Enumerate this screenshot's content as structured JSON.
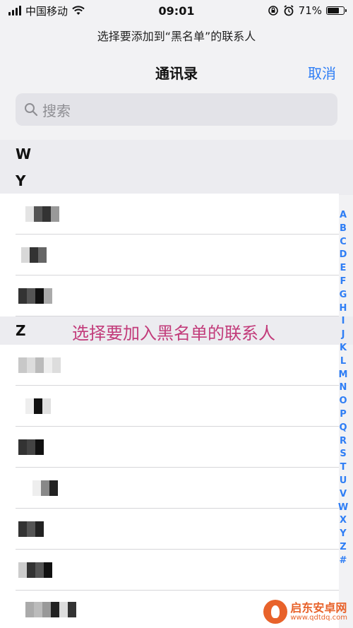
{
  "status_bar": {
    "carrier": "中国移动",
    "time": "09:01",
    "battery": "71%",
    "battery_level": 0.71
  },
  "header": {
    "prompt": "选择要添加到“黑名单”的联系人",
    "title": "通讯录",
    "cancel_label": "取消"
  },
  "search": {
    "placeholder": "搜索"
  },
  "sections": {
    "w": "W",
    "y": "Y",
    "z": "Z"
  },
  "annotation": "选择要加入黑名单的联系人",
  "index_letters": [
    "A",
    "B",
    "C",
    "D",
    "E",
    "F",
    "G",
    "H",
    "I",
    "J",
    "K",
    "L",
    "M",
    "N",
    "O",
    "P",
    "Q",
    "R",
    "S",
    "T",
    "U",
    "V",
    "W",
    "X",
    "Y",
    "Z",
    "#"
  ],
  "watermark": {
    "name": "启东安卓网",
    "url": "www.qdtdq.com"
  },
  "colors": {
    "accent": "#2f7ef5",
    "annotation": "#c23b7a",
    "watermark": "#e8622a"
  }
}
